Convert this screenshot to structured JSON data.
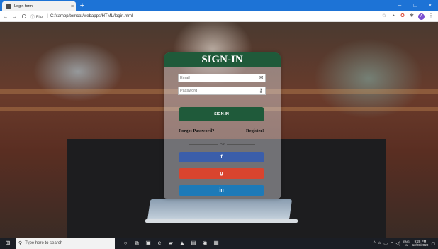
{
  "browser": {
    "tab_title": "Login form",
    "tab_close": "×",
    "new_tab": "+",
    "window_controls": {
      "minimize": "–",
      "maximize": "□",
      "close": "×"
    },
    "nav": {
      "back": "←",
      "forward": "→",
      "reload": "C"
    },
    "address": {
      "info_label": "ⓘ File",
      "separator": "|",
      "url": "C:/xampp/tomcat/webapps/HTML/login.html"
    },
    "toolbar_icons": [
      "☆",
      "◔",
      "O",
      "✱",
      "A",
      "⋮"
    ],
    "profile_initial": "A"
  },
  "login": {
    "title": "SIGN-IN",
    "email_placeholder": "Email",
    "password_placeholder": "Password",
    "signin_label": "SIGN-IN",
    "forgot_label": "Forgot Password?",
    "register_label": "Register!",
    "or_label": "OR",
    "facebook_label": "f",
    "google_label": "g",
    "linkedin_label": "in"
  },
  "taskbar": {
    "start": "⊞",
    "search_icon": "⚲",
    "search_placeholder": "Type here to search",
    "apps": [
      "○",
      "⧉",
      "▣",
      "e",
      "▰",
      "▲",
      "▤",
      "◉",
      "▦"
    ],
    "tray_icons": [
      "^",
      "⌂",
      "▭",
      "◔",
      "◁)"
    ],
    "lang_top": "ENG",
    "lang_bottom": "IN",
    "time": "9:28 PM",
    "date": "12/28/2020",
    "notifications": "▢"
  }
}
